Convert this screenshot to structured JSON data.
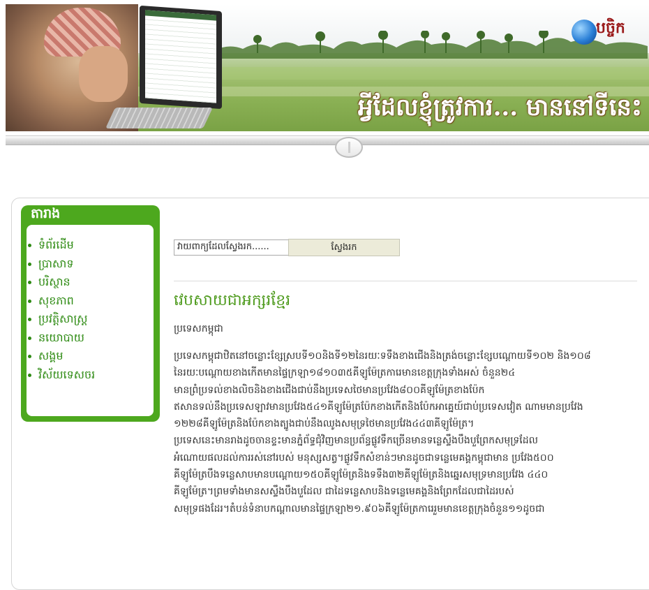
{
  "banner": {
    "logo_text": "បច្ចិក",
    "tagline": "អ្វីដែលខ្ញុំត្រូវការ...   មាននៅទីនេះ"
  },
  "sidebar": {
    "title": "តារាង",
    "items": [
      {
        "label": "ទំព័រដើម"
      },
      {
        "label": "ប្រាសាទ"
      },
      {
        "label": "បរិស្ថាន"
      },
      {
        "label": "សុខភាព"
      },
      {
        "label": "ប្រវត្តិសាស្ត្រ"
      },
      {
        "label": "នយោបាយ"
      },
      {
        "label": "សង្គម"
      },
      {
        "label": "វិស័យទេសចរ"
      }
    ]
  },
  "search": {
    "value": "វាយពាក្យដែលស្វែងរក......",
    "button_label": "ស្វែងរក"
  },
  "article": {
    "title": "វេបសាយជាអក្សរខ្មែរ",
    "subtitle": "ប្រទេសកម្ពុជា",
    "lines": [
      "ប្រទេសកម្ពុជាឋិតនៅចន្លោះខ្សែស្របទី១០និងទី១២នៃរយៈទទឹងខាងជើងនិងត្រង់ចន្លោះខ្សែបណ្ដោយទី១០២ និង១០៨",
      "នៃរយៈបណ្ដោយខាងកើតមានផ្ទៃក្រឡា១៨១០៣៥គីឡូម៉ែត្រការេមានខេត្តក្រុងទាំងអស់ ចំនួន២៤",
      "មានព្រំប្រទល់ខាងលិចនិងខាងជើងជាប់នឹងប្រទេសថៃមានប្រវែង៨០០គីឡូម៉ែត្រខាងប៉ែក",
      "ឥសានទល់នឹងប្រទេសឡាវមានប្រវែង៥៤១គីឡូម៉ែត្រប៉ែកខាងកើតនិងប៉ែកអាគ្នេយ៍ជាប់ប្រទេសវៀត ណាមមានប្រវែង",
      "១២២៨គីឡូម៉ែត្រនិងប៉ែកខាងត្បូងជាប់នឹងឈូងសមុទ្រថៃមានប្រវែង៤៤៣គីឡូម៉ែត្រ។",
      "ប្រទេសនេះមានរាងដូចចានខ្ទះមានភ្នំព័ទ្ធជុំវិញមានប្រព័ន្ធផ្លូវទឹកច្រើនមានទន្លេស្ទឹងបឹងបួព្រែកសមុទ្រដែល",
      "អំណោយផលដល់ការរស់នៅរបស់ មនុស្សសត្វ។ផ្លូវទឹកសំខាន់ៗមានដូចជាទន្លេមេគង្គកម្ពុជាមាន ប្រវែង៥០០",
      "គីឡូម៉ែត្របឹងទន្លេសាបមានបណ្ដោយ១៥០គីឡូម៉ែត្រនិងទទឹង៣២គីឡូម៉ែត្រនិងឆ្នេរសមុទ្រមានប្រវែង ៤៤០",
      "គីឡូម៉ែត្រ។ព្រមទាំងមានសស្ទឹងបឹងបួដែល ជាដៃទន្លេសាបនិងទន្លេមេគង្គនិងព្រែកដែលជាដៃរបស់",
      "សមុទ្រផងដែរ។តំបន់ទំនាបកណ្ដាលមានផ្ទៃក្រឡា២១.៩០៦គីឡូម៉ែត្រការេរួមមានខេត្តក្រុងចំនួន១១ដូចជា"
    ]
  }
}
